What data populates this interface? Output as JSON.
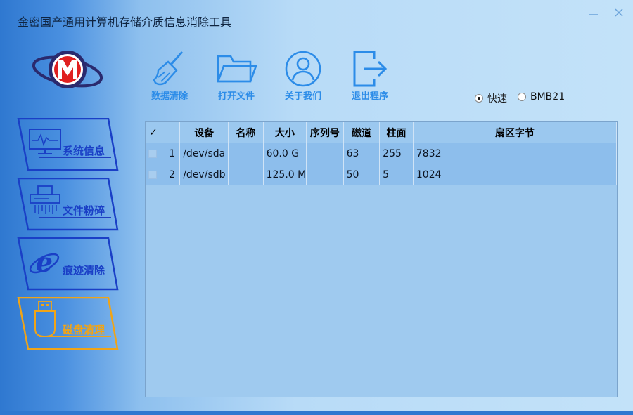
{
  "window": {
    "title": "金密国产通用计算机存储介质信息消除工具",
    "minimize_icon": "minimize-icon",
    "close_icon": "close-icon"
  },
  "sidebar": {
    "items": [
      {
        "label": "系统信息",
        "icon": "monitor-heartbeat-icon",
        "active": false
      },
      {
        "label": "文件粉碎",
        "icon": "shredder-icon",
        "active": false
      },
      {
        "label": "痕迹清除",
        "icon": "ie-browser-icon",
        "active": false
      },
      {
        "label": "磁盘清理",
        "icon": "usb-drive-icon",
        "active": true
      }
    ]
  },
  "toolbar": {
    "items": [
      {
        "label": "数据清除",
        "icon": "broom-icon"
      },
      {
        "label": "打开文件",
        "icon": "folder-open-icon"
      },
      {
        "label": "关于我们",
        "icon": "user-icon"
      },
      {
        "label": "退出程序",
        "icon": "exit-icon"
      }
    ]
  },
  "mode": {
    "options": [
      {
        "label": "快速",
        "selected": true
      },
      {
        "label": "BMB21",
        "selected": false
      }
    ]
  },
  "table": {
    "header_check": "✓",
    "columns": [
      "设备",
      "名称",
      "大小",
      "序列号",
      "磁道",
      "柱面",
      "扇区字节"
    ],
    "rows": [
      {
        "index": "1",
        "device": "/dev/sda",
        "name": "",
        "size": "60.0 G",
        "serial": "",
        "tracks": "63",
        "cylinders": "255",
        "sector_bytes": "7832"
      },
      {
        "index": "2",
        "device": "/dev/sdb",
        "name": "",
        "size": "125.0 M",
        "serial": "",
        "tracks": "50",
        "cylinders": "5",
        "sector_bytes": "1024"
      }
    ]
  },
  "colors": {
    "accent_blue": "#1a3fc6",
    "active_orange": "#f0a417",
    "toolbar_blue": "#2c8ce8",
    "logo_red": "#e02020",
    "logo_navy": "#2a2a6e"
  }
}
